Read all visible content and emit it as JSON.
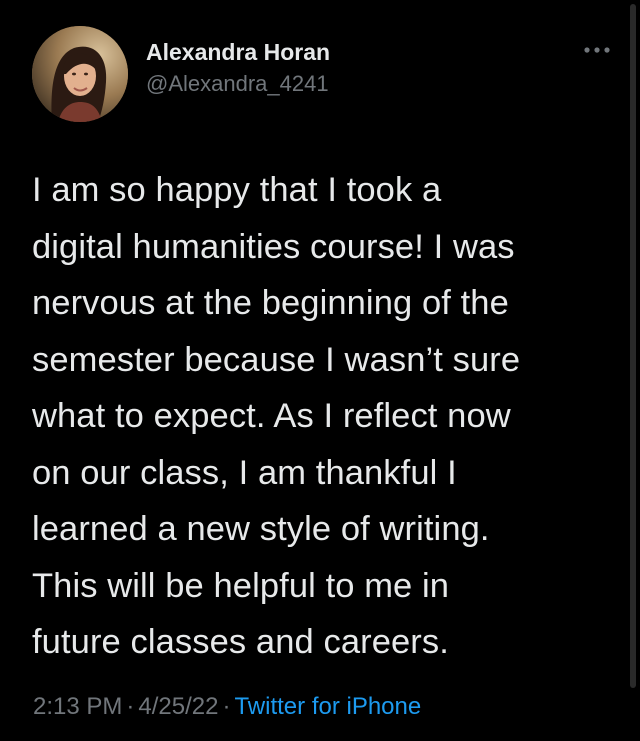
{
  "app": {
    "accent_color": "#1d9bf0",
    "background_color": "#000000"
  },
  "author": {
    "display_name": "Alexandra Horan",
    "handle": "@Alexandra_4241",
    "avatar": "profile-photo"
  },
  "header": {
    "more_icon": "more-options-icon"
  },
  "tweet": {
    "text": "I am so happy that I took a\ndigital humanities course! I was\nnervous at the beginning of the\nsemester because I wasn’t sure\nwhat to expect. As I reflect now\non our class, I am thankful I\nlearned a new style of writing.\nThis will be helpful to me in\nfuture classes and careers.",
    "time": "2:13 PM",
    "date": "4/25/22",
    "source": "Twitter for iPhone",
    "separator": "·"
  }
}
